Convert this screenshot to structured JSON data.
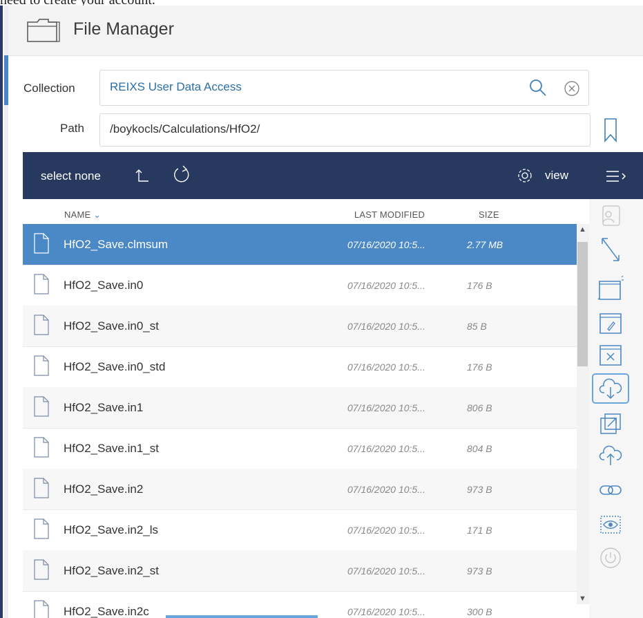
{
  "top_clip_text": "need to create your account.",
  "header": {
    "title": "File Manager",
    "icon": "folder-icon"
  },
  "collection": {
    "label": "Collection",
    "value": "REIXS User Data Access",
    "value_color": "#2a6fa8"
  },
  "path": {
    "label": "Path",
    "value": "/boykocls/Calculations/HfO2/"
  },
  "toolbar": {
    "select_none": "select none",
    "view": "view"
  },
  "columns": {
    "name": "NAME",
    "modified": "LAST MODIFIED",
    "size": "SIZE"
  },
  "files": [
    {
      "name": "HfO2_Save.clmsum",
      "modified": "07/16/2020 10:5...",
      "size": "2.77 MB",
      "selected": true
    },
    {
      "name": "HfO2_Save.in0",
      "modified": "07/16/2020 10:5...",
      "size": "176 B"
    },
    {
      "name": "HfO2_Save.in0_st",
      "modified": "07/16/2020 10:5...",
      "size": "85 B"
    },
    {
      "name": "HfO2_Save.in0_std",
      "modified": "07/16/2020 10:5...",
      "size": "176 B"
    },
    {
      "name": "HfO2_Save.in1",
      "modified": "07/16/2020 10:5...",
      "size": "806 B"
    },
    {
      "name": "HfO2_Save.in1_st",
      "modified": "07/16/2020 10:5...",
      "size": "804 B"
    },
    {
      "name": "HfO2_Save.in2",
      "modified": "07/16/2020 10:5...",
      "size": "973 B"
    },
    {
      "name": "HfO2_Save.in2_ls",
      "modified": "07/16/2020 10:5...",
      "size": "171 B"
    },
    {
      "name": "HfO2_Save.in2_st",
      "modified": "07/16/2020 10:5...",
      "size": "973 B"
    },
    {
      "name": "HfO2_Save.in2c",
      "modified": "07/16/2020 10:5...",
      "size": "300 B"
    }
  ],
  "side_tools": [
    "share-users-icon",
    "resize-icon",
    "new-folder-icon",
    "rename-folder-icon",
    "delete-folder-icon",
    "download-icon",
    "open-external-icon",
    "upload-icon",
    "link-icon",
    "preview-icon",
    "power-icon"
  ],
  "colors": {
    "toolbar_bg": "#28395f",
    "selected_row": "#4a88c6",
    "accent": "#4a88c6"
  }
}
